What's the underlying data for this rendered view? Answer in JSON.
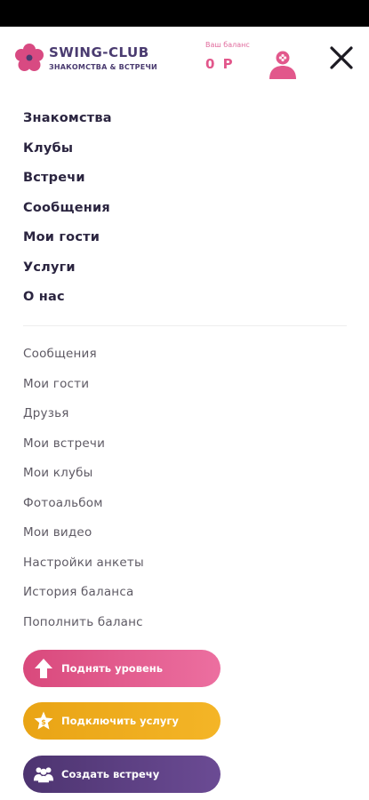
{
  "brand": {
    "name": "SWING-CLUB",
    "tagline": "ЗНАКОМСТВА & ВСТРЕЧИ"
  },
  "balance": {
    "label": "Ваш баланс",
    "value": "0 Р"
  },
  "icons": {
    "logo": "flower-logo-icon",
    "avatar": "user-avatar-icon",
    "close": "close-icon"
  },
  "colors": {
    "accent_pink": "#e2578b",
    "brand_purple": "#4a3b70",
    "orange": "#f0ab1c",
    "dark_purple": "#5a3f80"
  },
  "main_nav": [
    {
      "label": "Знакомства"
    },
    {
      "label": "Клубы"
    },
    {
      "label": "Встречи"
    },
    {
      "label": "Сообщения"
    },
    {
      "label": "Мои гости"
    },
    {
      "label": "Услуги"
    },
    {
      "label": "О нас"
    }
  ],
  "account_nav": [
    {
      "label": "Сообщения"
    },
    {
      "label": "Мои гости"
    },
    {
      "label": "Друзья"
    },
    {
      "label": "Мои встречи"
    },
    {
      "label": "Мои клубы"
    },
    {
      "label": "Фотоальбом"
    },
    {
      "label": "Мои видео"
    },
    {
      "label": "Настройки анкеты"
    },
    {
      "label": "История баланса"
    },
    {
      "label": "Пополнить баланс"
    }
  ],
  "actions": {
    "level_up": {
      "label": "Поднять уровень",
      "icon": "arrow-up-icon"
    },
    "service": {
      "label": "Подключить услугу",
      "icon": "star-icon"
    },
    "meeting": {
      "label": "Создать встречу",
      "icon": "people-icon"
    }
  }
}
